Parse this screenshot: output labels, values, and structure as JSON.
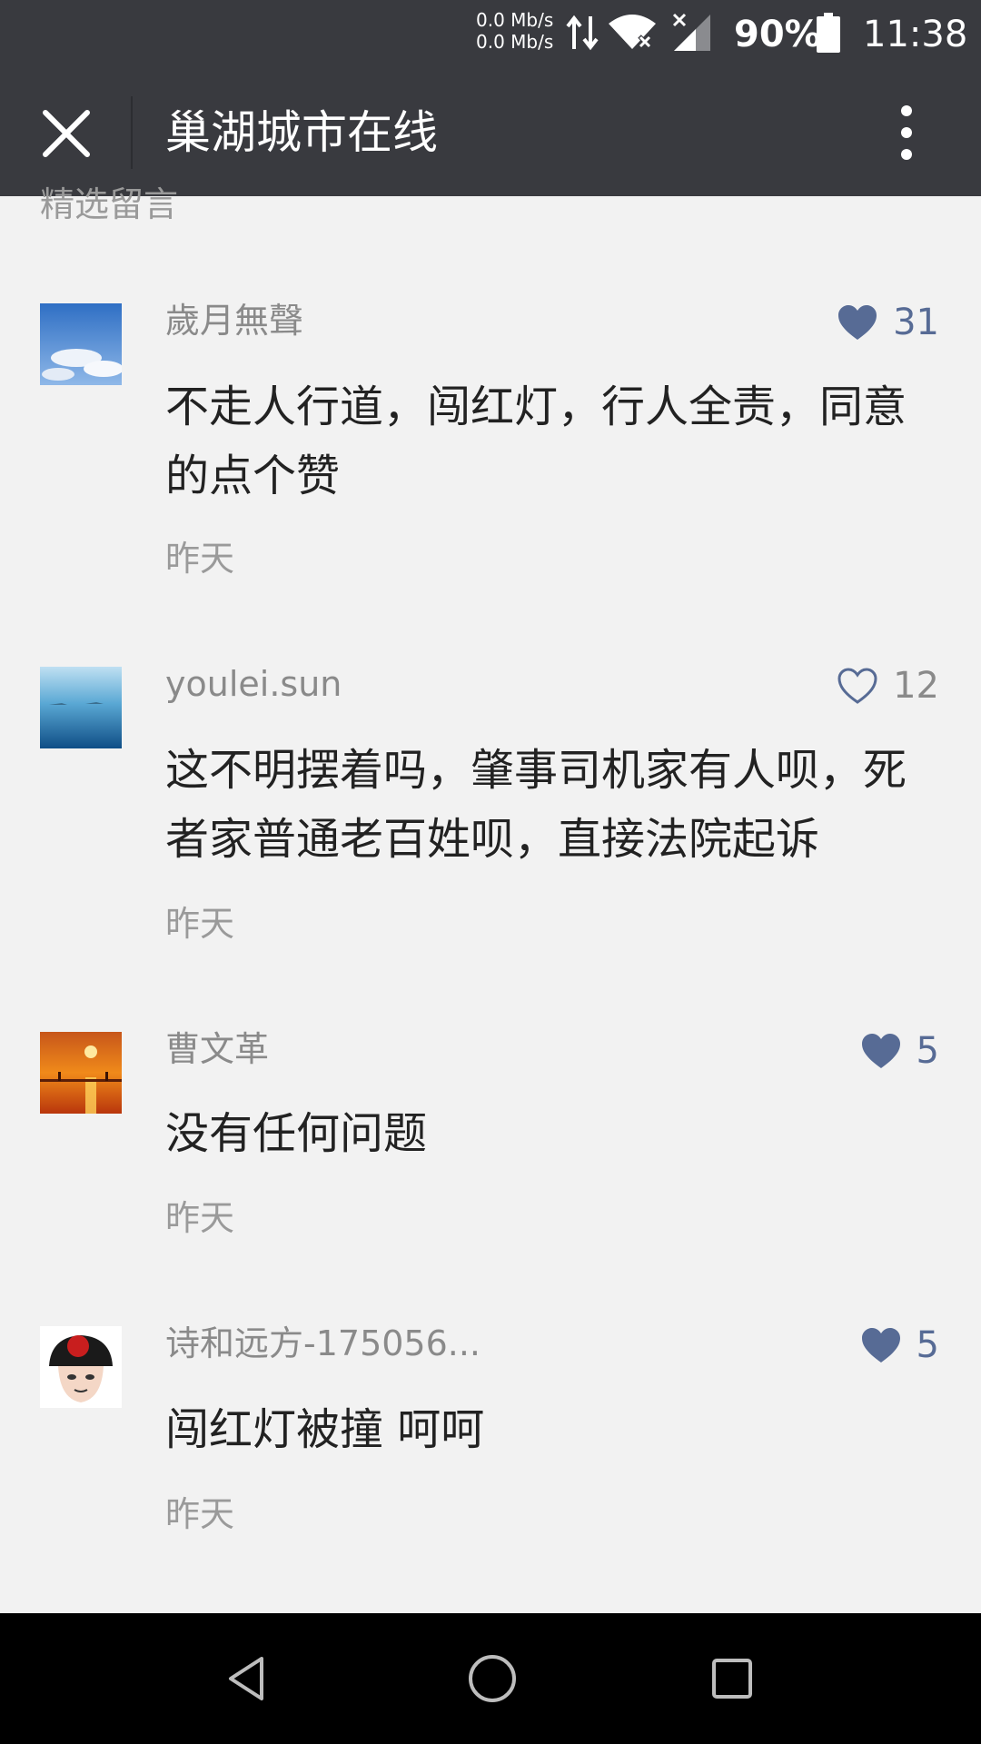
{
  "status_bar": {
    "net_up": "0.0 Mb/s",
    "net_down": "0.0 Mb/s",
    "battery_percent": "90%",
    "time": "11:38"
  },
  "header": {
    "title": "巢湖城市在线",
    "close_icon": "close-icon",
    "more_icon": "more-vertical-icon"
  },
  "section": {
    "title": "精选留言"
  },
  "comments": [
    {
      "username": "歲月無聲",
      "likes": "31",
      "liked": true,
      "content": "不走人行道，闯红灯，行人全责，同意的点个赞",
      "time": "昨天"
    },
    {
      "username": "youlei.sun",
      "likes": "12",
      "liked": false,
      "content": "这不明摆着吗，肇事司机家有人呗，死者家普通老百姓呗，直接法院起诉",
      "time": "昨天"
    },
    {
      "username": "曹文革",
      "likes": "5",
      "liked": true,
      "content": "没有任何问题",
      "time": "昨天"
    },
    {
      "username": "诗和远方-175056...",
      "likes": "5",
      "liked": true,
      "content": "闯红灯被撞 呵呵",
      "time": "昨天"
    }
  ],
  "colors": {
    "header_bg": "#393a3f",
    "accent": "#576b95",
    "page_bg": "#f2f2f2"
  }
}
